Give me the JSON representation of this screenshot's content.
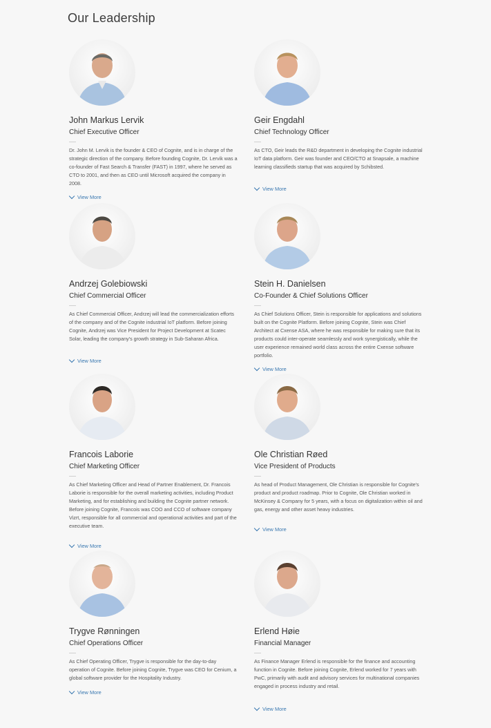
{
  "page": {
    "title": "Our Leadership"
  },
  "view_more_label": "View More",
  "leaders": [
    {
      "name": "John Markus Lervik",
      "role": "Chief Executive Officer",
      "bio": "Dr. John M. Lervik is the founder & CEO of Cognite, and is in charge of the strategic direction of the company. Before founding Cognite, Dr. Lervik was a co-founder of Fast Search & Transfer (FAST) in 1997, where he served as CTO to 2001, and then as CEO until Microsoft acquired the company in 2008."
    },
    {
      "name": "Geir Engdahl",
      "role": "Chief Technology Officer",
      "bio": "As CTO, Geir leads the R&D department in developing the Cognite industrial IoT data platform. Geir was founder and CEO/CTO at Snapsale, a machine learning classifieds startup that was acquired by Schibsted."
    },
    {
      "name": "Andrzej Golebiowski",
      "role": "Chief Commercial Officer",
      "bio": "As Chief Commercial Officer, Andrzej will lead the commercialization efforts of the company and of the Cognite industrial IoT platform. Before joining Cognite, Andrzej was Vice President for Project Development at Scatec Solar, leading the company's growth strategy in Sub-Saharan Africa."
    },
    {
      "name": "Stein H. Danielsen",
      "role": "Co-Founder & Chief Solutions Officer",
      "bio": "As Chief Solutions Officer, Stein is responsible for applications and solutions built on the Cognite Platform. Before joining Cognite, Stein was Chief Architect at Cxense ASA, where he was responsible for making sure that its products could inter-operate seamlessly and work synergistically, while the user experience remained world class across the entire Cxense software portfolio."
    },
    {
      "name": "Francois Laborie",
      "role": "Chief Marketing Officer",
      "bio": "As Chief Marketing Officer and Head of Partner Enablement, Dr. Francois Laborie is responsible for the overall marketing activities, including Product Marketing, and for establishing and building the Cognite partner network. Before joining Cognite, Francois was COO and CCO of software company Vizrt, responsible for all commercial and operational activities and part of the executive team."
    },
    {
      "name": "Ole Christian Røed",
      "role": "Vice President of Products",
      "bio": "As head of Product Management, Ole Christian is responsible for Cognite's product and product roadmap. Prior to Cognite, Ole Christian worked in McKinsey & Company for 5 years, with a focus on digitalization within oil and gas, energy and other asset heavy industries."
    },
    {
      "name": "Trygve Rønningen",
      "role": "Chief Operations Officer",
      "bio": "As Chief Operating Officer, Trygve is responsible for the day-to-day operation of Cognite. Before joining Cognite, Trygve was CEO for Cenium, a global software provider for the Hospitality Industry."
    },
    {
      "name": "Erlend Høie",
      "role": "Financial Manager",
      "bio": "As Finance Manager Erlend is responsible for the finance and accounting function in Cognite. Before joining Cognite, Erlend worked for 7 years with PwC, primarily with audit and advisory services for multinational companies engaged in process industry and retail."
    }
  ]
}
